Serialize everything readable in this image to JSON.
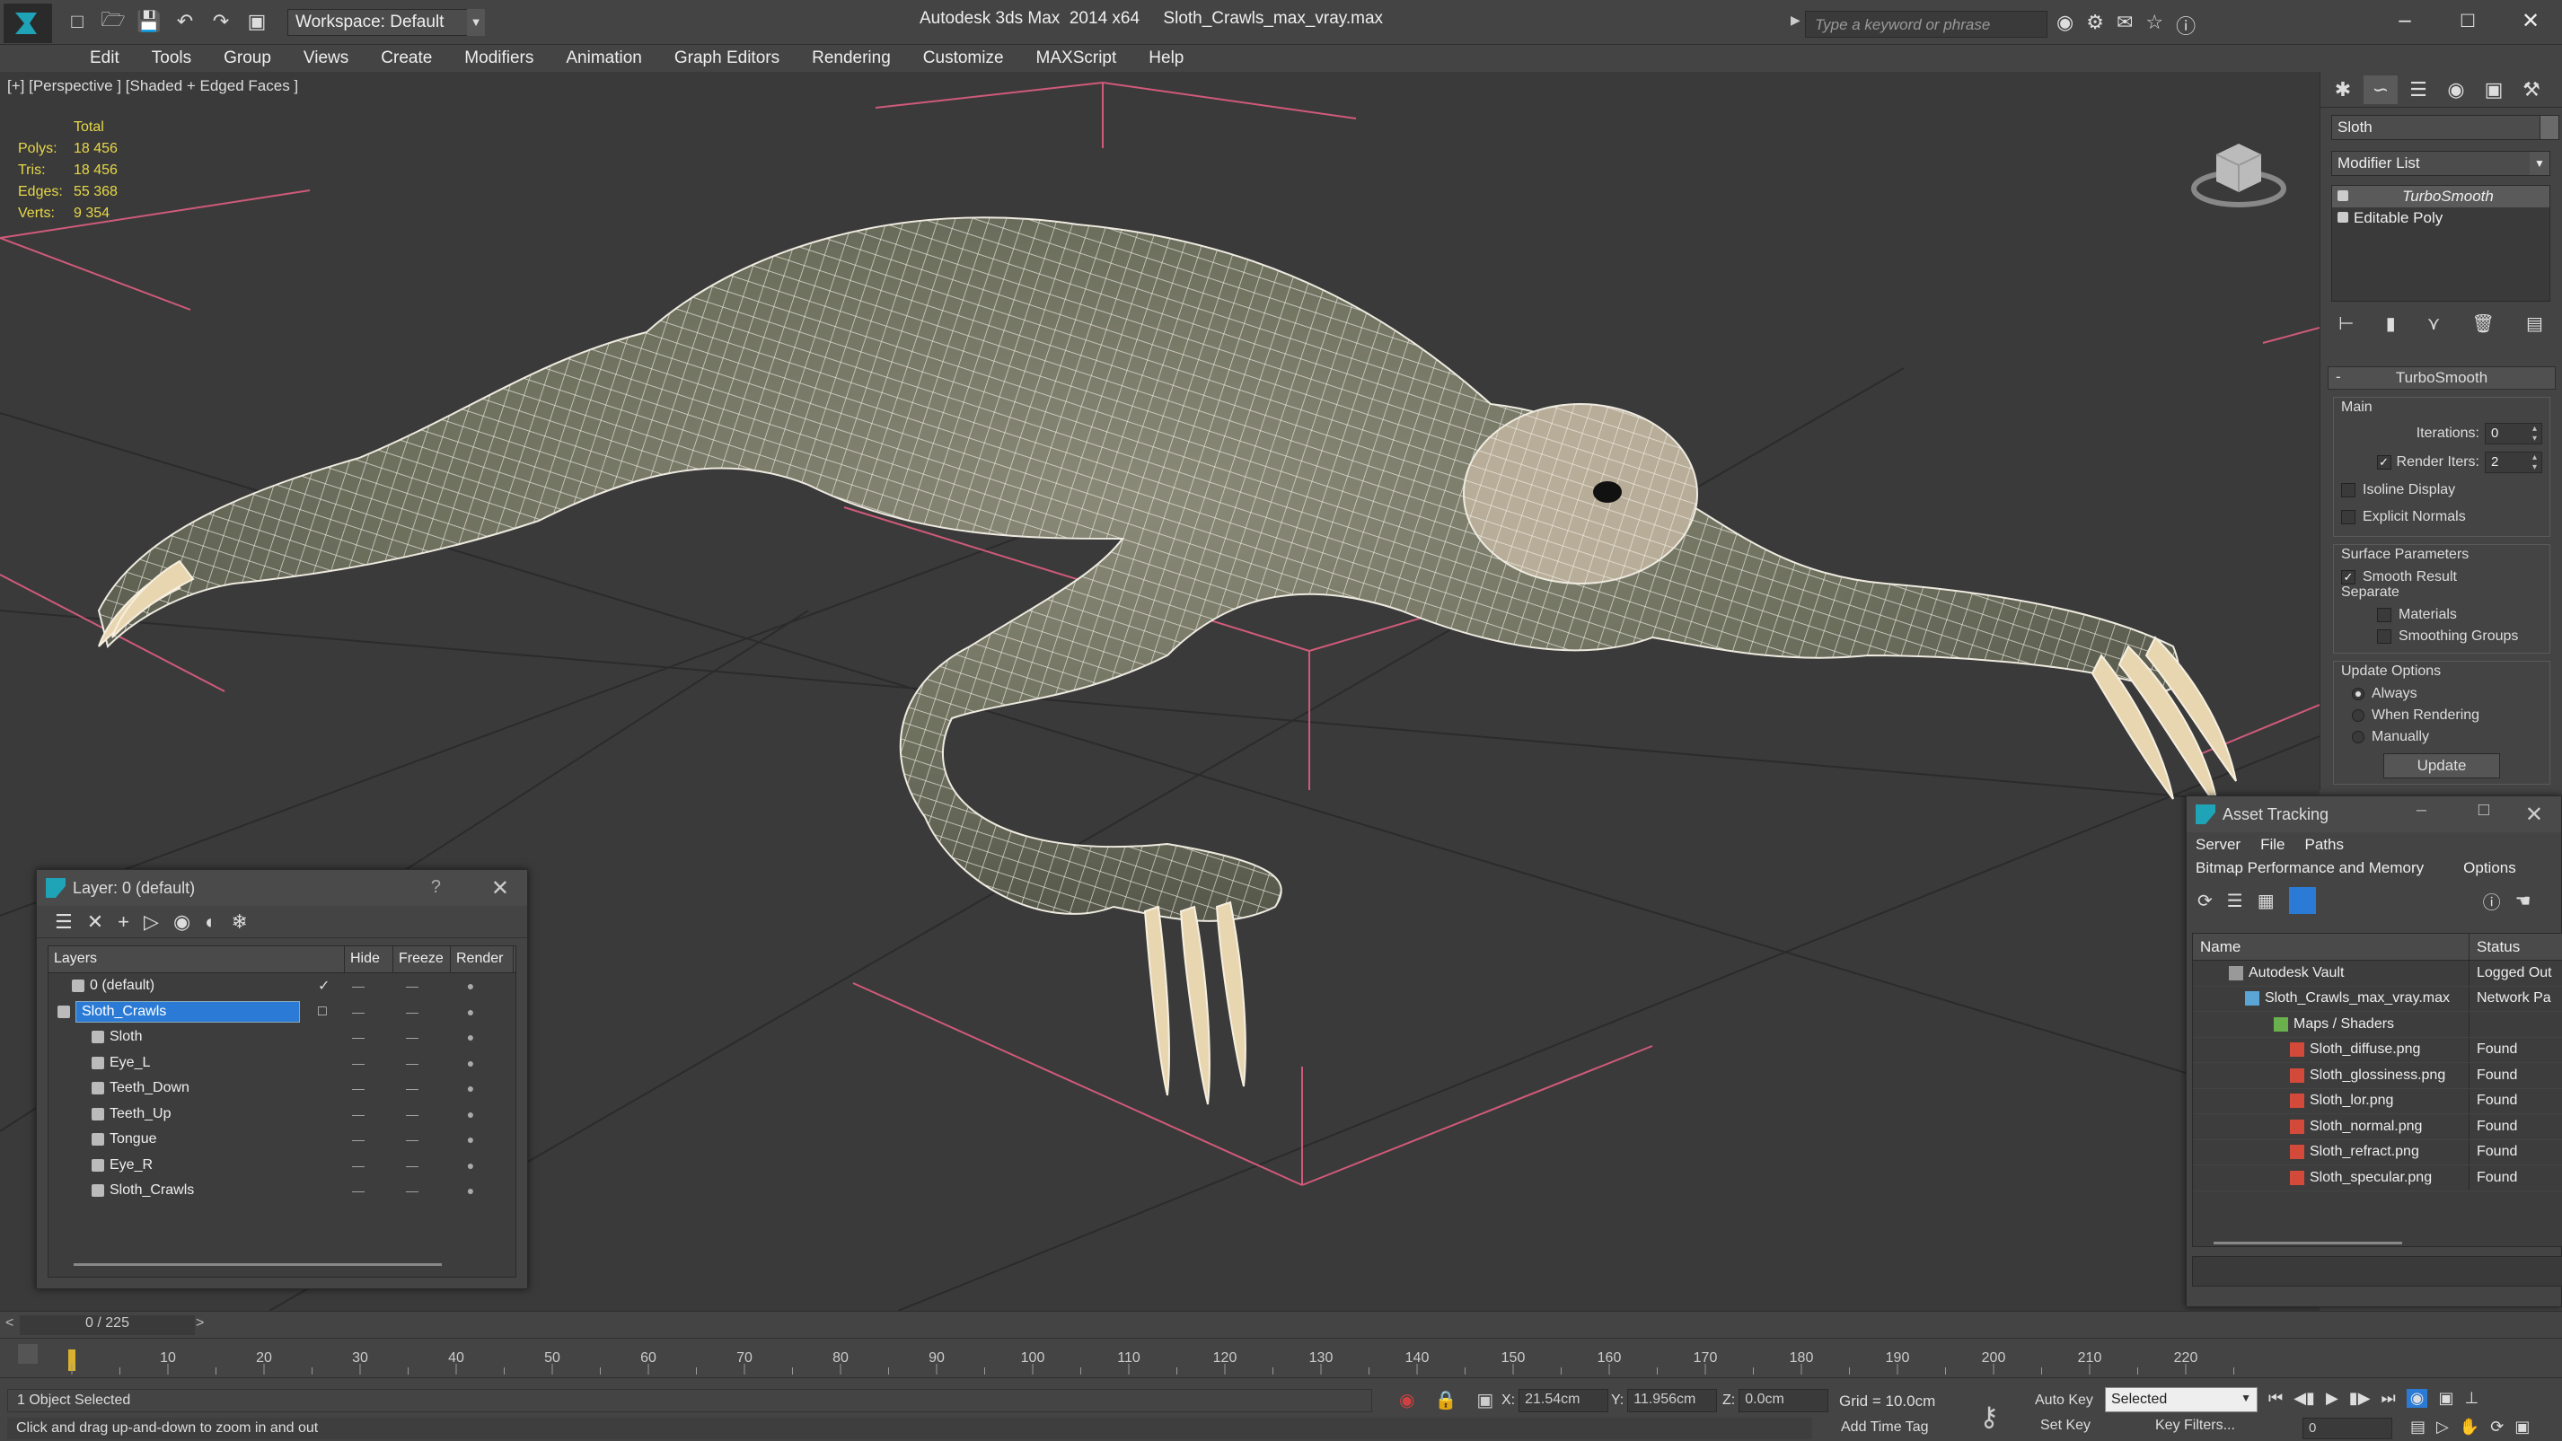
{
  "window": {
    "title": "Autodesk 3ds Max  2014 x64     Sloth_Crawls_max_vray.max",
    "workspace": "Workspace: Default",
    "search_placeholder": "Type a keyword or phrase"
  },
  "menu": [
    "Edit",
    "Tools",
    "Group",
    "Views",
    "Create",
    "Modifiers",
    "Animation",
    "Graph Editors",
    "Rendering",
    "Customize",
    "MAXScript",
    "Help"
  ],
  "viewport": {
    "label": "[+] [Perspective ] [Shaded + Edged Faces ]",
    "stats": {
      "header": "Total",
      "rows": [
        {
          "k": "Polys:",
          "v": "18 456"
        },
        {
          "k": "Tris:",
          "v": "18 456"
        },
        {
          "k": "Edges:",
          "v": "55 368"
        },
        {
          "k": "Verts:",
          "v": "9 354"
        }
      ]
    }
  },
  "command_panel": {
    "object_name": "Sloth",
    "modifier_list": "Modifier List",
    "stack": [
      "TurboSmooth",
      "Editable Poly"
    ],
    "rollout_title": "TurboSmooth",
    "main_group": "Main",
    "iterations_label": "Iterations:",
    "iterations_value": "0",
    "render_iters_label": "Render Iters:",
    "render_iters_value": "2",
    "isoline": "Isoline Display",
    "explicit_normals": "Explicit Normals",
    "surface_group": "Surface Parameters",
    "smooth_result": "Smooth Result",
    "separate": "Separate",
    "materials": "Materials",
    "smoothing_groups": "Smoothing Groups",
    "update_group": "Update Options",
    "always": "Always",
    "when_rendering": "When Rendering",
    "manually": "Manually",
    "update_button": "Update"
  },
  "layer_dialog": {
    "title": "Layer: 0 (default)",
    "help": "?",
    "columns": [
      "Layers",
      "Hide",
      "Freeze",
      "Render"
    ],
    "rows": [
      {
        "name": "0 (default)",
        "indent": 1
      },
      {
        "name": "Sloth_Crawls",
        "indent": 1
      },
      {
        "name": "Sloth",
        "indent": 2
      },
      {
        "name": "Eye_L",
        "indent": 2
      },
      {
        "name": "Teeth_Down",
        "indent": 2
      },
      {
        "name": "Teeth_Up",
        "indent": 2
      },
      {
        "name": "Tongue",
        "indent": 2
      },
      {
        "name": "Eye_R",
        "indent": 2
      },
      {
        "name": "Sloth_Crawls",
        "indent": 2
      }
    ]
  },
  "asset_dialog": {
    "title": "Asset Tracking",
    "menu1": [
      "Server",
      "File",
      "Paths"
    ],
    "menu2": [
      "Bitmap Performance and Memory",
      "Options"
    ],
    "columns": [
      "Name",
      "Status"
    ],
    "rows": [
      {
        "name": "Autodesk Vault",
        "status": "Logged Out",
        "icon": "vault"
      },
      {
        "name": "Sloth_Crawls_max_vray.max",
        "status": "Network Pa",
        "icon": "max"
      },
      {
        "name": "Maps / Shaders",
        "status": "",
        "icon": "folder"
      },
      {
        "name": "Sloth_diffuse.png",
        "status": "Found",
        "icon": "png"
      },
      {
        "name": "Sloth_glossiness.png",
        "status": "Found",
        "icon": "png"
      },
      {
        "name": "Sloth_lor.png",
        "status": "Found",
        "icon": "png"
      },
      {
        "name": "Sloth_normal.png",
        "status": "Found",
        "icon": "png"
      },
      {
        "name": "Sloth_refract.png",
        "status": "Found",
        "icon": "png"
      },
      {
        "name": "Sloth_specular.png",
        "status": "Found",
        "icon": "png"
      }
    ]
  },
  "timeline": {
    "frame": "0 / 225",
    "ticks": [
      "10",
      "20",
      "30",
      "40",
      "50",
      "60",
      "70",
      "80",
      "90",
      "100",
      "110",
      "120",
      "130",
      "140",
      "150",
      "160",
      "170",
      "180",
      "190",
      "200",
      "210",
      "220"
    ]
  },
  "status": {
    "selection": "1 Object Selected",
    "prompt": "Click and drag up-and-down to zoom in and out",
    "x_label": "X:",
    "x": "21.54cm",
    "y_label": "Y:",
    "y": "11.956cm",
    "z_label": "Z:",
    "z": "0.0cm",
    "grid": "Grid = 10.0cm",
    "add_time_tag": "Add Time Tag",
    "auto_key": "Auto Key",
    "set_key": "Set Key",
    "key_mode": "Selected",
    "key_filters": "Key Filters...",
    "current_frame": "0"
  }
}
